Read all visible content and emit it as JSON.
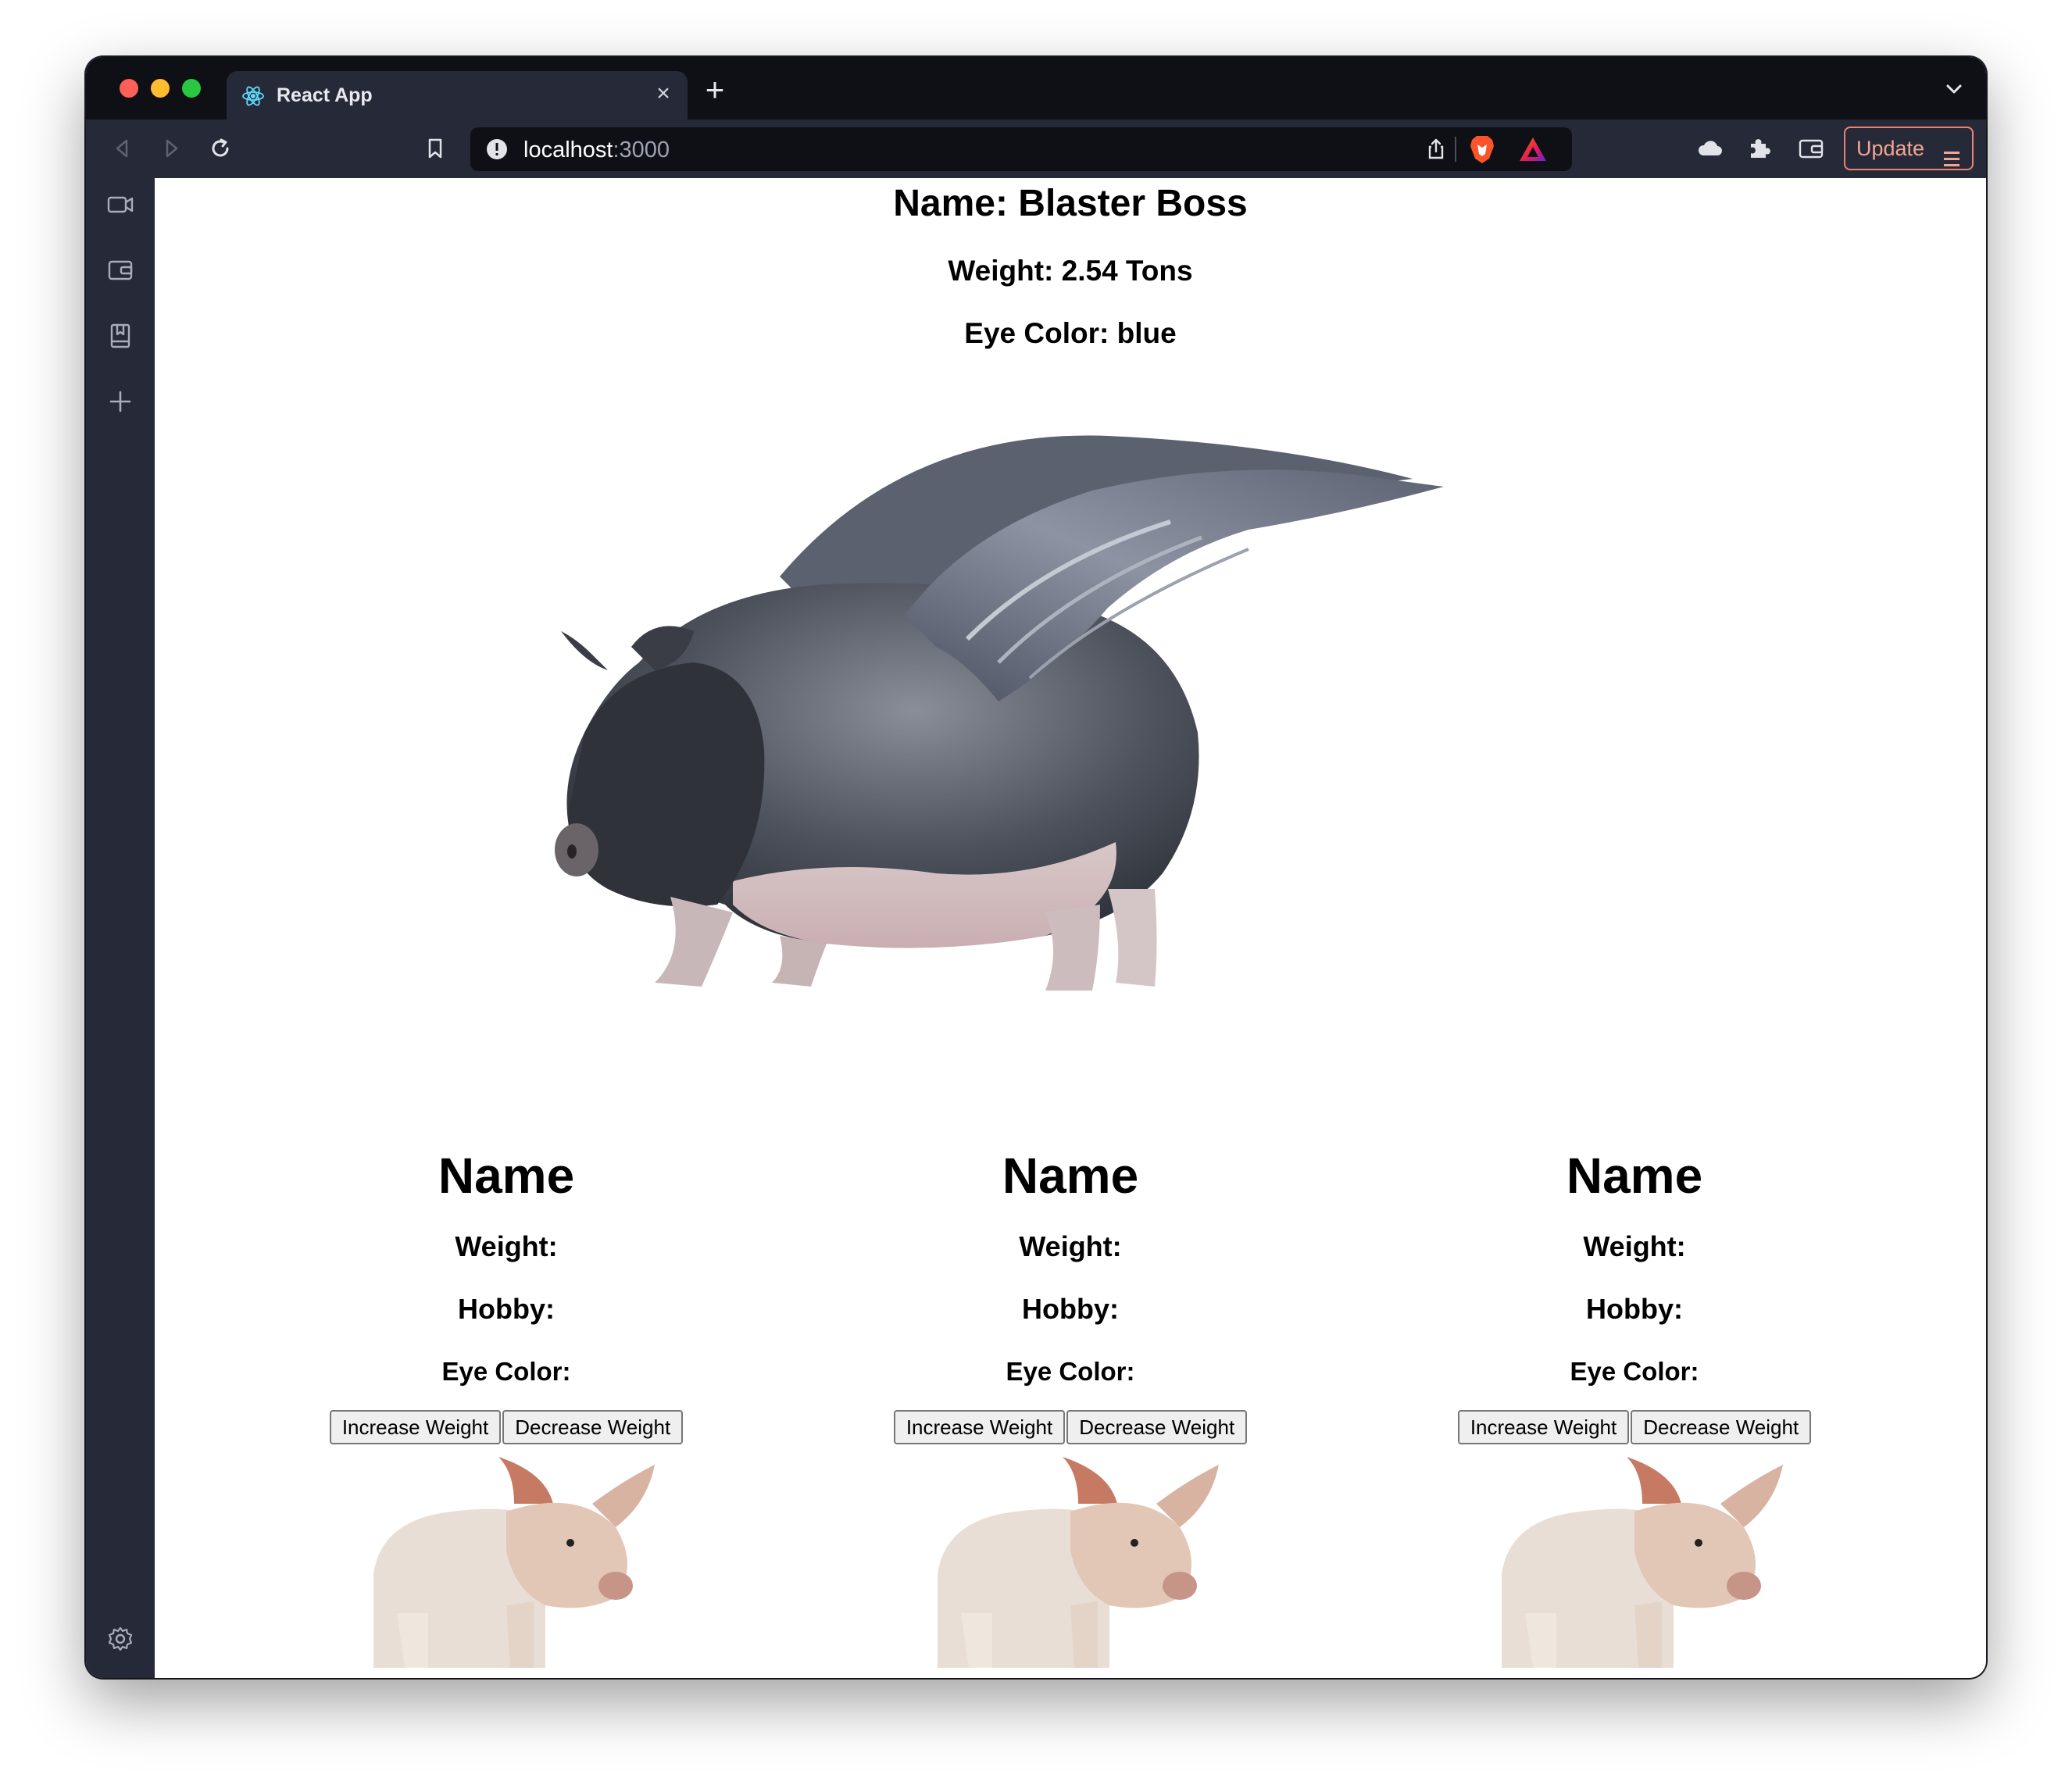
{
  "browser": {
    "tab_title": "React App",
    "url_host": "localhost",
    "url_port": ":3000",
    "update_label": "Update",
    "close_glyph": "×",
    "new_tab_glyph": "+"
  },
  "featured": {
    "name": "Name: Blaster Boss",
    "weight": "Weight: 2.54 Tons",
    "eye_color": "Eye Color: blue"
  },
  "cards": [
    {
      "name": "Name",
      "weight": "Weight:",
      "hobby": "Hobby:",
      "eye_color": "Eye Color:",
      "increase": "Increase Weight",
      "decrease": "Decrease Weight"
    },
    {
      "name": "Name",
      "weight": "Weight:",
      "hobby": "Hobby:",
      "eye_color": "Eye Color:",
      "increase": "Increase Weight",
      "decrease": "Decrease Weight"
    },
    {
      "name": "Name",
      "weight": "Weight:",
      "hobby": "Hobby:",
      "eye_color": "Eye Color:",
      "increase": "Increase Weight",
      "decrease": "Decrease Weight"
    }
  ],
  "colors": {
    "chrome_dark": "#0f1016",
    "chrome_mid": "#262a38",
    "update_accent": "#e9846f",
    "brave_orange": "#fb542b"
  },
  "icons": [
    "react-icon",
    "back-icon",
    "forward-icon",
    "reload-icon",
    "bookmark-icon",
    "site-info-icon",
    "share-icon",
    "brave-shield-icon",
    "brave-rewards-icon",
    "cloud-icon",
    "extensions-icon",
    "wallet-icon",
    "video-icon",
    "reading-list-icon",
    "add-icon",
    "settings-icon"
  ]
}
